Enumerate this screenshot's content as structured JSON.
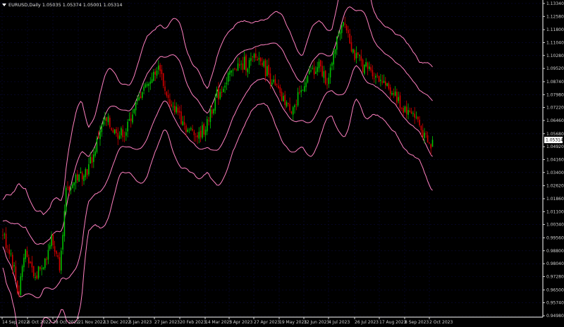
{
  "window": {
    "symbol_line": "EURUSD,Daily  1.05035 1.05374 1.05001 1.05314",
    "menu_arrow": "triangle-down-icon"
  },
  "colors": {
    "background": "#000000",
    "grid": "#0a0a3a",
    "bull": "#00c000",
    "bear": "#d00000",
    "band": "#ff80c0",
    "axis_text": "#d0d0d0",
    "price_tag_bg": "#ffffff",
    "price_tag_text": "#000000"
  },
  "chart_data": {
    "type": "candlestick",
    "symbol": "EURUSD",
    "timeframe": "Daily",
    "last_price_label": "1.05314",
    "ylim": [
      0.9498,
      1.1342
    ],
    "price_ticks": [
      "1.13340",
      "1.12580",
      "1.11800",
      "1.11040",
      "1.10280",
      "1.09520",
      "1.08740",
      "1.07980",
      "1.07220",
      "1.06460",
      "1.05680",
      "1.04920",
      "1.04160",
      "1.03400",
      "1.02620",
      "1.01860",
      "1.01100",
      "1.00340",
      "0.99560",
      "0.98800",
      "0.98040",
      "0.97280",
      "0.96500",
      "0.95740",
      "0.94980"
    ],
    "date_ticks": [
      "14 Sep 2022",
      "6 Oct 2022",
      "28 Oct 2022",
      "21 Nov 2022",
      "13 Dec 2022",
      "5 Jan 2023",
      "27 Jan 2023",
      "20 Feb 2023",
      "14 Mar 2023",
      "5 Apr 2023",
      "27 Apr 2023",
      "19 May 2023",
      "12 Jun 2023",
      "4 Jul 2023",
      "26 Jul 2023",
      "17 Aug 2023",
      "8 Sep 2023",
      "2 Oct 2023"
    ],
    "close_path": [
      [
        "2022-09-14",
        0.998
      ],
      [
        "2022-09-22",
        0.985
      ],
      [
        "2022-09-28",
        0.962
      ],
      [
        "2022-10-04",
        0.99
      ],
      [
        "2022-10-12",
        0.972
      ],
      [
        "2022-10-20",
        0.98
      ],
      [
        "2022-10-28",
        0.995
      ],
      [
        "2022-11-04",
        0.98
      ],
      [
        "2022-11-10",
        1.022
      ],
      [
        "2022-11-18",
        1.03
      ],
      [
        "2022-11-28",
        1.035
      ],
      [
        "2022-12-06",
        1.048
      ],
      [
        "2022-12-14",
        1.065
      ],
      [
        "2022-12-22",
        1.06
      ],
      [
        "2023-01-02",
        1.055
      ],
      [
        "2023-01-10",
        1.072
      ],
      [
        "2023-01-18",
        1.083
      ],
      [
        "2023-01-26",
        1.09
      ],
      [
        "2023-02-02",
        1.096
      ],
      [
        "2023-02-10",
        1.075
      ],
      [
        "2023-02-20",
        1.068
      ],
      [
        "2023-02-28",
        1.06
      ],
      [
        "2023-03-08",
        1.056
      ],
      [
        "2023-03-16",
        1.062
      ],
      [
        "2023-03-24",
        1.078
      ],
      [
        "2023-04-03",
        1.088
      ],
      [
        "2023-04-12",
        1.096
      ],
      [
        "2023-04-20",
        1.098
      ],
      [
        "2023-04-28",
        1.102
      ],
      [
        "2023-05-05",
        1.1
      ],
      [
        "2023-05-12",
        1.09
      ],
      [
        "2023-05-22",
        1.078
      ],
      [
        "2023-05-31",
        1.07
      ],
      [
        "2023-06-08",
        1.078
      ],
      [
        "2023-06-16",
        1.092
      ],
      [
        "2023-06-26",
        1.095
      ],
      [
        "2023-07-04",
        1.088
      ],
      [
        "2023-07-12",
        1.115
      ],
      [
        "2023-07-18",
        1.125
      ],
      [
        "2023-07-26",
        1.105
      ],
      [
        "2023-08-03",
        1.098
      ],
      [
        "2023-08-11",
        1.095
      ],
      [
        "2023-08-21",
        1.088
      ],
      [
        "2023-08-30",
        1.083
      ],
      [
        "2023-09-08",
        1.073
      ],
      [
        "2023-09-18",
        1.068
      ],
      [
        "2023-09-26",
        1.06
      ],
      [
        "2023-10-03",
        1.048
      ],
      [
        "2023-10-06",
        1.0531
      ]
    ],
    "bands": {
      "type": "envelope",
      "visible": true
    },
    "grid": true,
    "price_axis": "right",
    "time_axis": "bottom"
  }
}
